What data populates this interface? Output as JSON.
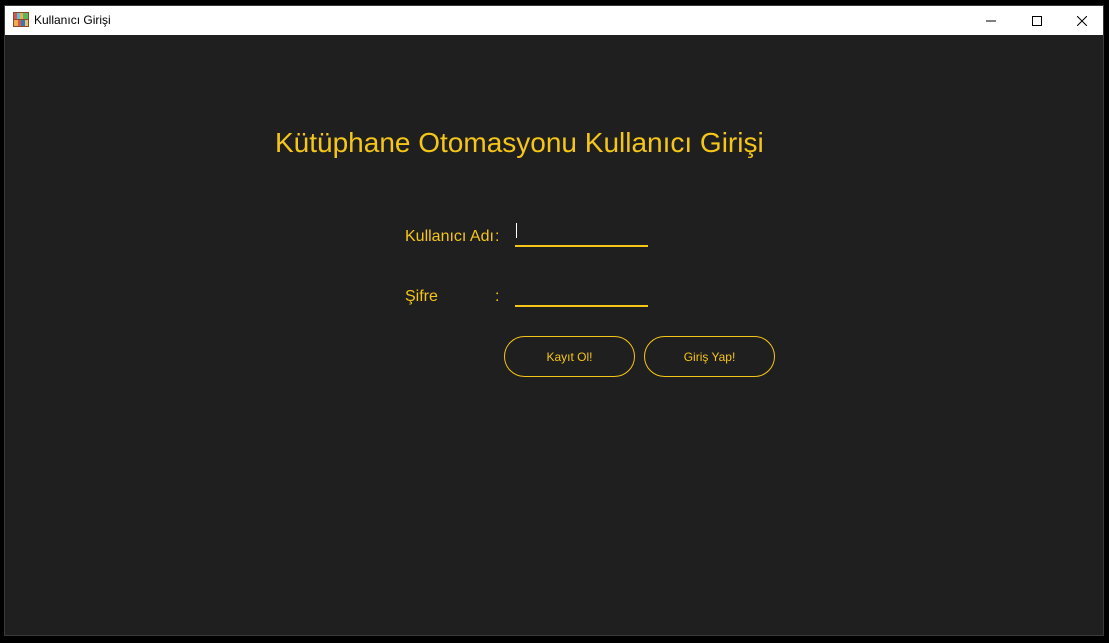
{
  "window": {
    "title": "Kullanıcı Girişi",
    "app_icon": "bookshelf-icon",
    "controls": [
      "minimize-icon",
      "maximize-icon",
      "close-icon"
    ]
  },
  "form": {
    "heading": "Kütüphane Otomasyonu Kullanıcı Girişi",
    "username_label": "Kullanıcı Adı",
    "password_label": "Şifre",
    "colon": ":",
    "username_value": "",
    "password_value": ""
  },
  "buttons": {
    "register_label": "Kayıt Ol!",
    "login_label": "Giriş Yap!"
  },
  "colors": {
    "accent": "#f5c518",
    "background": "#1f1f1f",
    "titlebar": "#ffffff"
  }
}
